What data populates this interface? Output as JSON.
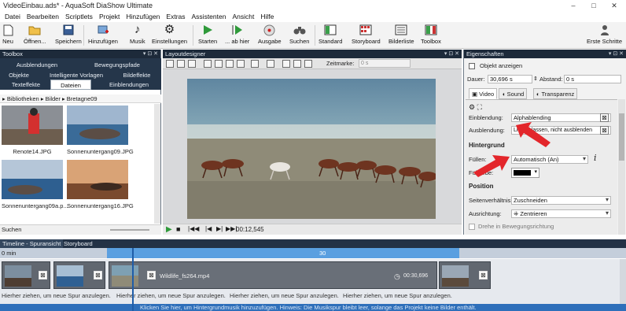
{
  "window": {
    "title": "VideoEinbau.ads* - AquaSoft DiaShow Ultimate"
  },
  "menu": [
    "Datei",
    "Bearbeiten",
    "Scriptlets",
    "Projekt",
    "Hinzufügen",
    "Extras",
    "Assistenten",
    "Ansicht",
    "Hilfe"
  ],
  "toolbar": {
    "neu": "Neu",
    "oeffnen": "Öffnen...",
    "speichern": "Speichern",
    "hinzufuegen": "Hinzufügen",
    "musik": "Musik",
    "einstellungen": "Einstellungen",
    "starten": "Starten",
    "ab_hier": "... ab hier",
    "ausgabe": "Ausgabe",
    "suchen": "Suchen",
    "standard": "Standard",
    "storyboard": "Storyboard",
    "bilderliste": "Bilderliste",
    "toolbox": "Toolbox",
    "erste_schritte": "Erste Schritte"
  },
  "toolbox": {
    "title": "Toolbox",
    "tabs": [
      "Ausblendungen",
      "Bewegungspfade",
      "Objekte",
      "Intelligente Vorlagen",
      "Bildeffekte",
      "Texteffekte",
      "Dateien",
      "Einblendungen"
    ],
    "breadcrumb": [
      "Bibliotheken",
      "Bilder",
      "Bretagne09"
    ],
    "files": [
      "Renote14.JPG",
      "Sonnenuntergang09.JPG",
      "Sonnenuntergang09a.p...",
      "Sonnenuntergang16.JPG"
    ],
    "search_label": "Suchen"
  },
  "layout": {
    "title": "Layoutdesigner",
    "zeitmarke_label": "Zeitmarke:",
    "zeitmarke_value": "0 s",
    "play_time": "00:12,545"
  },
  "props": {
    "title": "Eigenschaften",
    "objekt_anzeigen": "Objekt anzeigen",
    "dauer_label": "Dauer:",
    "dauer_value": "30,696 s",
    "abstand_label": "Abstand:",
    "abstand_value": "0 s",
    "tabs": [
      "Video",
      "Sound",
      "Transparenz"
    ],
    "einblendung_label": "Einblendung:",
    "einblendung_value": "Alphablending",
    "ausblendung_label": "Ausblendung:",
    "ausblendung_value": "Liegen lassen, nicht ausblenden",
    "hintergrund": "Hintergrund",
    "fuellen_label": "Füllen:",
    "fuellen_value": "Automatisch (An)",
    "fuellfarbe_label": "Füllfarbe:",
    "position": "Position",
    "seitenverh_label": "Seitenverhältnis:",
    "seitenverh_value": "Zuschneiden",
    "ausrichtung_label": "Ausrichtung:",
    "ausrichtung_value": "Zentrieren",
    "drehe_label": "Drehe in Bewegungsrichtung"
  },
  "timeline": {
    "tabs": [
      "Timeline - Spuransicht",
      "Storyboard"
    ],
    "ruler_start": "0 min",
    "ruler_mark": "30",
    "clip_name": "Wildlife_fs264.mp4",
    "clip_time": "00:30,696",
    "hint": "Hierher ziehen, um neue Spur anzulegen.",
    "status": "Klicken Sie hier, um Hintergrundmusik hinzuzufügen. Hinweis: Die Musikspur bleibt leer, solange das Projekt keine Bilder enthält."
  },
  "colors": {
    "panel_head": "#1d2a3a",
    "accent_blue": "#5a9fe0",
    "arrow_red": "#e3262b"
  }
}
